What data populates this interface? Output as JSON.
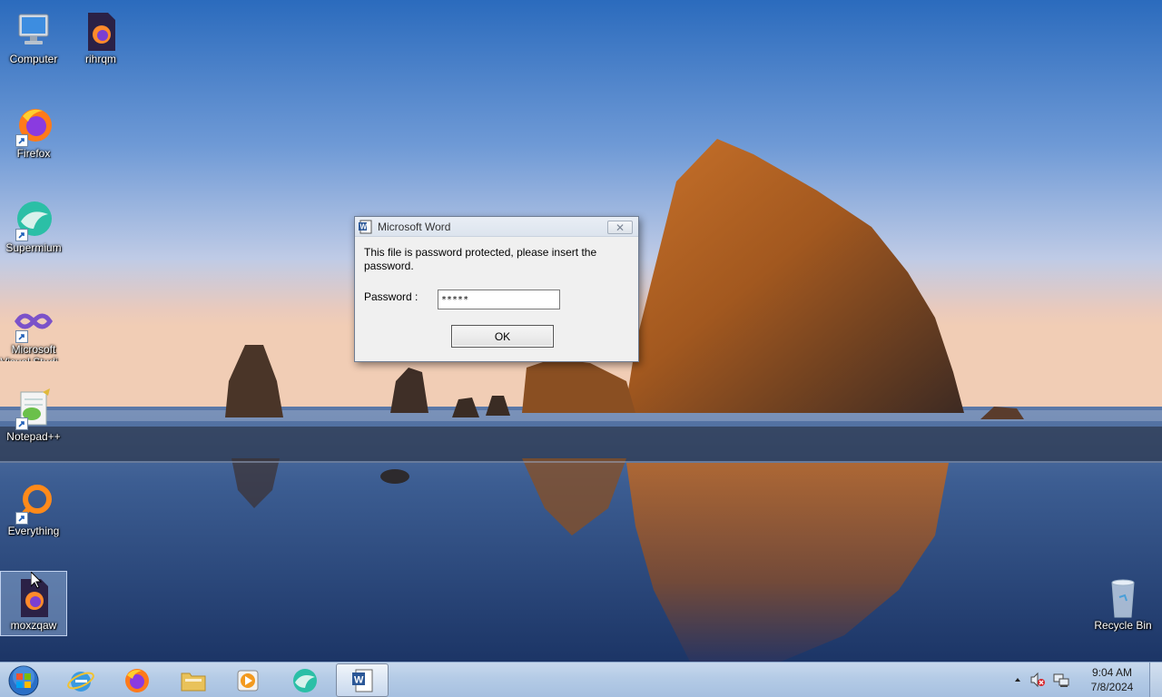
{
  "desktop_icons": [
    {
      "id": "computer",
      "label": "Computer"
    },
    {
      "id": "rihrqm",
      "label": "rihrqm"
    },
    {
      "id": "firefox",
      "label": "Firefox"
    },
    {
      "id": "supermium",
      "label": "Supermium"
    },
    {
      "id": "visual-studio",
      "label": "Microsoft Visual Studi..."
    },
    {
      "id": "notepadpp",
      "label": "Notepad++"
    },
    {
      "id": "everything",
      "label": "Everything"
    },
    {
      "id": "moxzqaw",
      "label": "moxzqaw"
    },
    {
      "id": "recycle-bin",
      "label": "Recycle Bin"
    }
  ],
  "dialog": {
    "title": "Microsoft Word",
    "message": "This file is password protected, please insert the password.",
    "password_label": "Password :",
    "password_value": "*****",
    "ok_label": "OK",
    "close_glyph": "✕"
  },
  "taskbar": {
    "apps": [
      "start-orb",
      "internet-explorer",
      "firefox",
      "file-explorer",
      "media-player",
      "supermium",
      "microsoft-word"
    ],
    "active_app": "microsoft-word",
    "clock_time": "9:04 AM",
    "clock_date": "7/8/2024",
    "tray_icons": [
      "show-hidden-icons-arrow",
      "volume-muted-icon",
      "network-icon"
    ]
  },
  "colors": {
    "taskbar": "#b4cbe6",
    "dialog_bg": "#f0f0f0",
    "icon_label": "#ffffff"
  }
}
